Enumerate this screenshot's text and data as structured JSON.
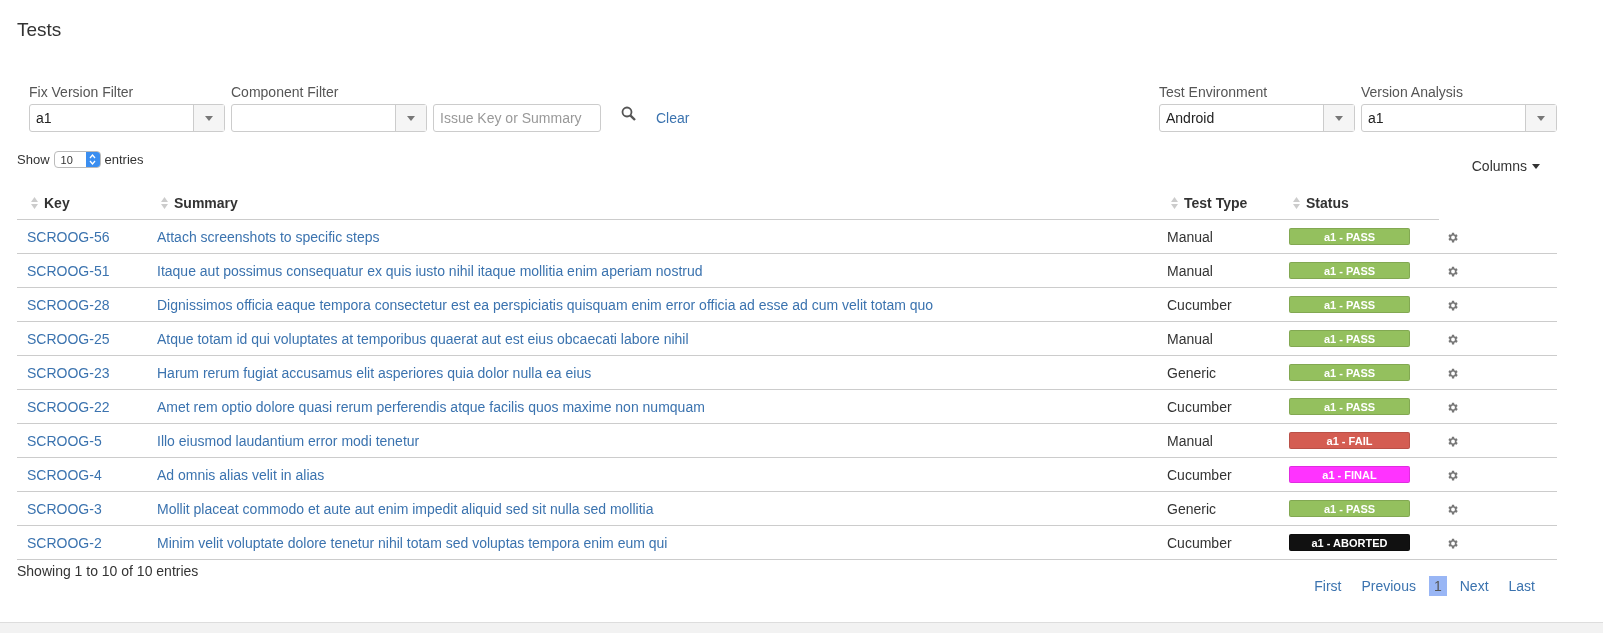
{
  "page": {
    "title": "Tests"
  },
  "filters_left": [
    {
      "label": "Fix Version Filter",
      "kind": "select",
      "value": "a1"
    },
    {
      "label": "Component Filter",
      "kind": "select"
    },
    {
      "kind": "search",
      "placeholder": "Issue Key or Summary"
    }
  ],
  "clear_link": "Clear",
  "filters_right": [
    {
      "label": "Test Environment",
      "kind": "select",
      "value": "Android"
    },
    {
      "label": "Version Analysis",
      "kind": "select",
      "value": "a1"
    }
  ],
  "length_control": {
    "before": "Show",
    "value": "10",
    "after": "entries"
  },
  "columns_button": "Columns",
  "table": {
    "columns": [
      "Key",
      "Summary",
      "Test Type",
      "Status"
    ],
    "rows": [
      {
        "key": "SCROOG-56",
        "summary": "Attach screenshots to specific steps",
        "test_type": "Manual",
        "status": "a1 - PASS",
        "color": "#94c05e"
      },
      {
        "key": "SCROOG-51",
        "summary": "Itaque aut possimus consequatur ex quis iusto nihil itaque mollitia enim aperiam nostrud",
        "test_type": "Manual",
        "status": "a1 - PASS",
        "color": "#94c05e"
      },
      {
        "key": "SCROOG-28",
        "summary": "Dignissimos officia eaque tempora consectetur est ea perspiciatis quisquam enim error officia ad esse ad cum velit totam quo",
        "test_type": "Cucumber",
        "status": "a1 - PASS",
        "color": "#94c05e"
      },
      {
        "key": "SCROOG-25",
        "summary": "Atque totam id qui voluptates at temporibus quaerat aut est eius obcaecati labore nihil",
        "test_type": "Manual",
        "status": "a1 - PASS",
        "color": "#94c05e"
      },
      {
        "key": "SCROOG-23",
        "summary": "Harum rerum fugiat accusamus elit asperiores quia dolor nulla ea eius",
        "test_type": "Generic",
        "status": "a1 - PASS",
        "color": "#94c05e"
      },
      {
        "key": "SCROOG-22",
        "summary": "Amet rem optio dolore quasi rerum perferendis atque facilis quos maxime non numquam",
        "test_type": "Cucumber",
        "status": "a1 - PASS",
        "color": "#94c05e"
      },
      {
        "key": "SCROOG-5",
        "summary": "Illo eiusmod laudantium error modi tenetur",
        "test_type": "Manual",
        "status": "a1 - FAIL",
        "color": "#d45d52"
      },
      {
        "key": "SCROOG-4",
        "summary": "Ad omnis alias velit in alias",
        "test_type": "Cucumber",
        "status": "a1 - FINAL",
        "color": "#ff33ff"
      },
      {
        "key": "SCROOG-3",
        "summary": "Mollit placeat commodo et aute aut enim impedit aliquid sed sit nulla sed mollitia",
        "test_type": "Generic",
        "status": "a1 - PASS",
        "color": "#94c05e"
      },
      {
        "key": "SCROOG-2",
        "summary": "Minim velit voluptate dolore tenetur nihil totam sed voluptas tempora enim eum qui",
        "test_type": "Cucumber",
        "status": "a1 - ABORTED",
        "color": "#111111"
      }
    ]
  },
  "info": "Showing 1 to 10 of 10 entries",
  "pagination": [
    {
      "label": "First",
      "selected": false
    },
    {
      "label": "Previous",
      "selected": false
    },
    {
      "label": "1",
      "selected": true
    },
    {
      "label": "Next",
      "selected": false
    },
    {
      "label": "Last",
      "selected": false
    }
  ]
}
